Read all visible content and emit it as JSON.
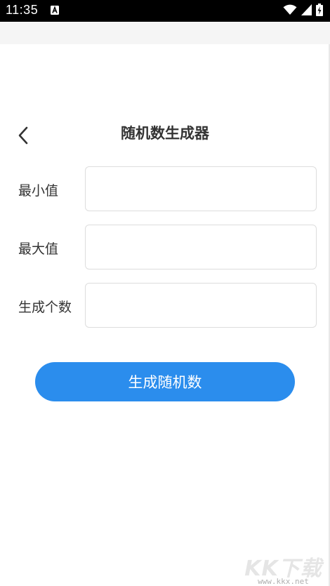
{
  "status_bar": {
    "time": "11:35"
  },
  "header": {
    "title": "随机数生成器"
  },
  "form": {
    "fields": [
      {
        "label": "最小值",
        "value": "",
        "placeholder": ""
      },
      {
        "label": "最大值",
        "value": "",
        "placeholder": ""
      },
      {
        "label": "生成个数",
        "value": "",
        "placeholder": ""
      }
    ]
  },
  "generate_button": {
    "label": "生成随机数"
  },
  "watermark": {
    "brand": "KK下载",
    "url": "www.kkx.net"
  },
  "colors": {
    "accent": "#2b8ded",
    "text": "#333333",
    "input_border": "#dddddd"
  },
  "icons": {
    "back": "chevron-left-icon",
    "wifi": "wifi-icon",
    "signal": "signal-icon",
    "battery": "battery-charging-icon",
    "notification": "a-notification-icon"
  }
}
